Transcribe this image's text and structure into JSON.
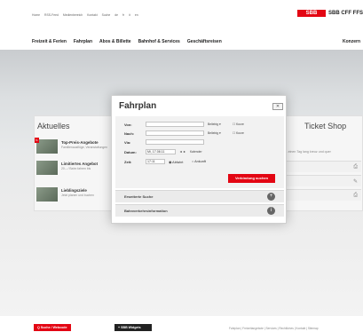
{
  "header": {
    "utility_links": [
      "Home",
      "RSS-Feed",
      "Medienbereich",
      "Kontakt",
      "Suche",
      "de",
      "fr",
      "it",
      "en"
    ],
    "brand_mark": "SBB",
    "brand_name": "SBB CFF FFS"
  },
  "nav": {
    "items": [
      "Freizeit & Ferien",
      "Fahrplan",
      "Abos & Billette",
      "Bahnhof & Services",
      "Geschäftsreisen"
    ],
    "right_item": "Konzern"
  },
  "aktuelles": {
    "title": "Aktuelles",
    "items": [
      {
        "title": "Top-Preis-Angebote",
        "subtitle": "Familienausflüge, Veranstaltungen",
        "badge": "%"
      },
      {
        "title": "Limitiertes Angebot",
        "subtitle": "20.– / Bahn fahren bis",
        "badge": ""
      },
      {
        "title": "Lieblingsziele",
        "subtitle": "Jetzt planen und buchen",
        "badge": ""
      }
    ]
  },
  "ticket_shop": {
    "title": "Ticket Shop",
    "text": "…einen Tag lang kreuz und quer",
    "rows": [
      "⎙",
      "✎",
      "⎙"
    ]
  },
  "fahrplan": {
    "title": "Fahrplan",
    "close": "✕",
    "von_label": "Von:",
    "von_value": "",
    "nach_label": "Nach:",
    "nach_value": "",
    "via_label": "Via:",
    "via_value": "",
    "beliebig": "Beliebig ▾",
    "kurze_umst": "☐ Kurze",
    "datum_label": "Datum:",
    "datum_value": "Mi, 17.08.11",
    "datum_nav": "◄ ►",
    "kalender": "Kalender",
    "zeit_label": "Zeit:",
    "zeit_value": "17:11",
    "abfahrt": "◉ Abfahrt",
    "ankunft": "○ Ankunft",
    "submit": "Verbindung suchen",
    "erweiterte_suche": "Erweiterte Suche",
    "bahnverkehrsinfo": "Bahnverkehrsinformation",
    "plus_icon": "+",
    "info_icon": "i"
  },
  "footer": {
    "suche_button": "Q  Suche / Webcode",
    "widgets_button": "+  SBB Widgets",
    "links": "Fahrplan | Freizeitangebote | Services | Rechtliches | Kontakt | Sitemap"
  },
  "colors": {
    "accent": "#e30613",
    "dark": "#222222"
  }
}
